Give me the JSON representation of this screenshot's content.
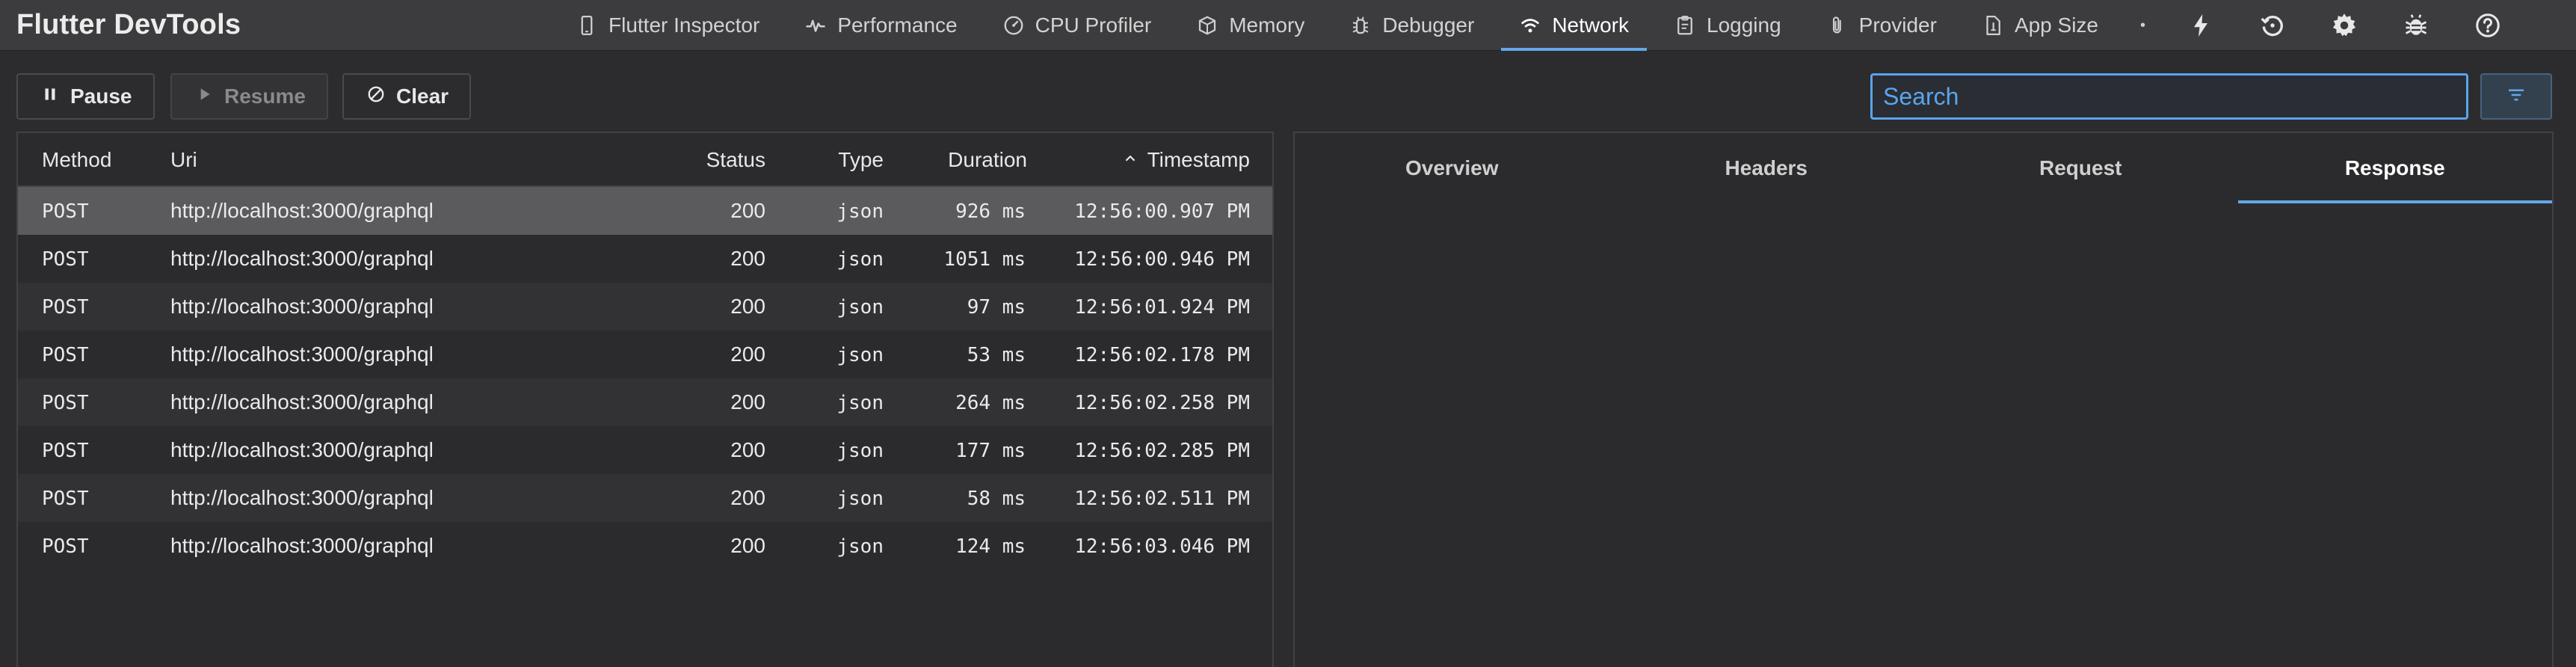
{
  "app": {
    "title": "Flutter DevTools"
  },
  "nav": {
    "tabs": [
      {
        "label": "Flutter Inspector",
        "icon": "phone-icon",
        "active": false
      },
      {
        "label": "Performance",
        "icon": "pulse-icon",
        "active": false
      },
      {
        "label": "CPU Profiler",
        "icon": "gauge-icon",
        "active": false
      },
      {
        "label": "Memory",
        "icon": "cube-icon",
        "active": false
      },
      {
        "label": "Debugger",
        "icon": "debugger-icon",
        "active": false
      },
      {
        "label": "Network",
        "icon": "wifi-icon",
        "active": true
      },
      {
        "label": "Logging",
        "icon": "clipboard-icon",
        "active": false
      },
      {
        "label": "Provider",
        "icon": "paperclip-icon",
        "active": false
      },
      {
        "label": "App Size",
        "icon": "app-size-icon",
        "active": false
      }
    ],
    "actions": [
      "lightning-icon",
      "history-icon",
      "gear-icon",
      "bug-icon",
      "help-icon"
    ]
  },
  "toolbar": {
    "pause_label": "Pause",
    "resume_label": "Resume",
    "clear_label": "Clear",
    "search_placeholder": "Search"
  },
  "table": {
    "columns": {
      "method": "Method",
      "uri": "Uri",
      "status": "Status",
      "type": "Type",
      "duration": "Duration",
      "timestamp": "Timestamp"
    },
    "sort_column": "timestamp",
    "sort_direction": "ascending",
    "rows": [
      {
        "method": "POST",
        "uri": "http://localhost:3000/graphql",
        "status": "200",
        "type": "json",
        "duration": "926 ms",
        "timestamp": "12:56:00.907 PM",
        "selected": true
      },
      {
        "method": "POST",
        "uri": "http://localhost:3000/graphql",
        "status": "200",
        "type": "json",
        "duration": "1051 ms",
        "timestamp": "12:56:00.946 PM",
        "selected": false
      },
      {
        "method": "POST",
        "uri": "http://localhost:3000/graphql",
        "status": "200",
        "type": "json",
        "duration": "97 ms",
        "timestamp": "12:56:01.924 PM",
        "selected": false
      },
      {
        "method": "POST",
        "uri": "http://localhost:3000/graphql",
        "status": "200",
        "type": "json",
        "duration": "53 ms",
        "timestamp": "12:56:02.178 PM",
        "selected": false
      },
      {
        "method": "POST",
        "uri": "http://localhost:3000/graphql",
        "status": "200",
        "type": "json",
        "duration": "264 ms",
        "timestamp": "12:56:02.258 PM",
        "selected": false
      },
      {
        "method": "POST",
        "uri": "http://localhost:3000/graphql",
        "status": "200",
        "type": "json",
        "duration": "177 ms",
        "timestamp": "12:56:02.285 PM",
        "selected": false
      },
      {
        "method": "POST",
        "uri": "http://localhost:3000/graphql",
        "status": "200",
        "type": "json",
        "duration": "58 ms",
        "timestamp": "12:56:02.511 PM",
        "selected": false
      },
      {
        "method": "POST",
        "uri": "http://localhost:3000/graphql",
        "status": "200",
        "type": "json",
        "duration": "124 ms",
        "timestamp": "12:56:03.046 PM",
        "selected": false
      }
    ]
  },
  "details": {
    "tabs": [
      {
        "label": "Overview",
        "active": false
      },
      {
        "label": "Headers",
        "active": false
      },
      {
        "label": "Request",
        "active": false
      },
      {
        "label": "Response",
        "active": true
      }
    ]
  },
  "colors": {
    "accent": "#62a8e8",
    "background": "#2c2c2e",
    "topbar": "#3c3c3f",
    "selected_row": "#5b5b5e"
  }
}
